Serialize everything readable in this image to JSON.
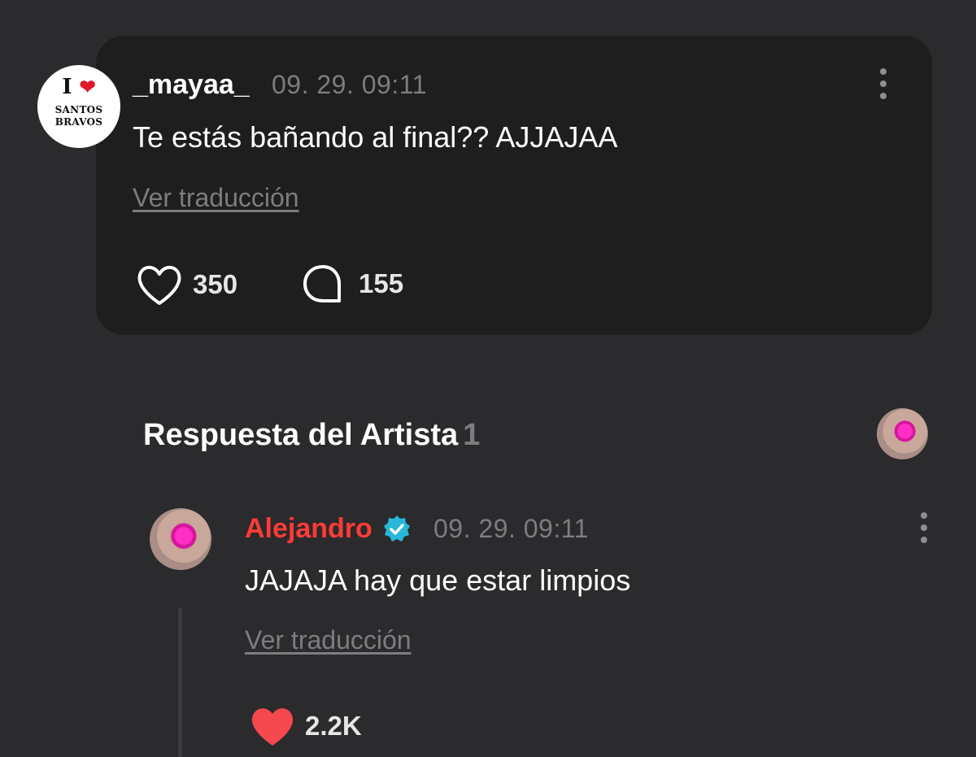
{
  "comment": {
    "avatar_logo": {
      "top_letter": "I",
      "words": [
        "SANTOS",
        "BRAVOS"
      ]
    },
    "username": "_mayaa_",
    "timestamp": "09. 29. 09:11",
    "text": "Te estás bañando al final?? AJJAJAA",
    "translate_label": "Ver traducción",
    "likes": "350",
    "replies": "155"
  },
  "artist_section": {
    "title": "Respuesta del Artista",
    "count": "1"
  },
  "reply": {
    "author": "Alejandro",
    "verified": true,
    "timestamp": "09. 29. 09:11",
    "text": "JAJAJA hay que estar limpios",
    "translate_label": "Ver traducción",
    "likes": "2.2K"
  },
  "colors": {
    "background": "#2b2a2c",
    "card": "#1e1e1f",
    "artist_name": "#ff3b36",
    "liked_heart": "#f5484f",
    "verified_badge": "#27b8d9",
    "muted_text": "#7d7c7f"
  },
  "icons": {
    "like": "heart-outline-icon",
    "reply": "speech-bubble-icon",
    "more": "more-vertical-icon",
    "verified": "verified-badge-icon",
    "liked": "heart-filled-icon"
  }
}
